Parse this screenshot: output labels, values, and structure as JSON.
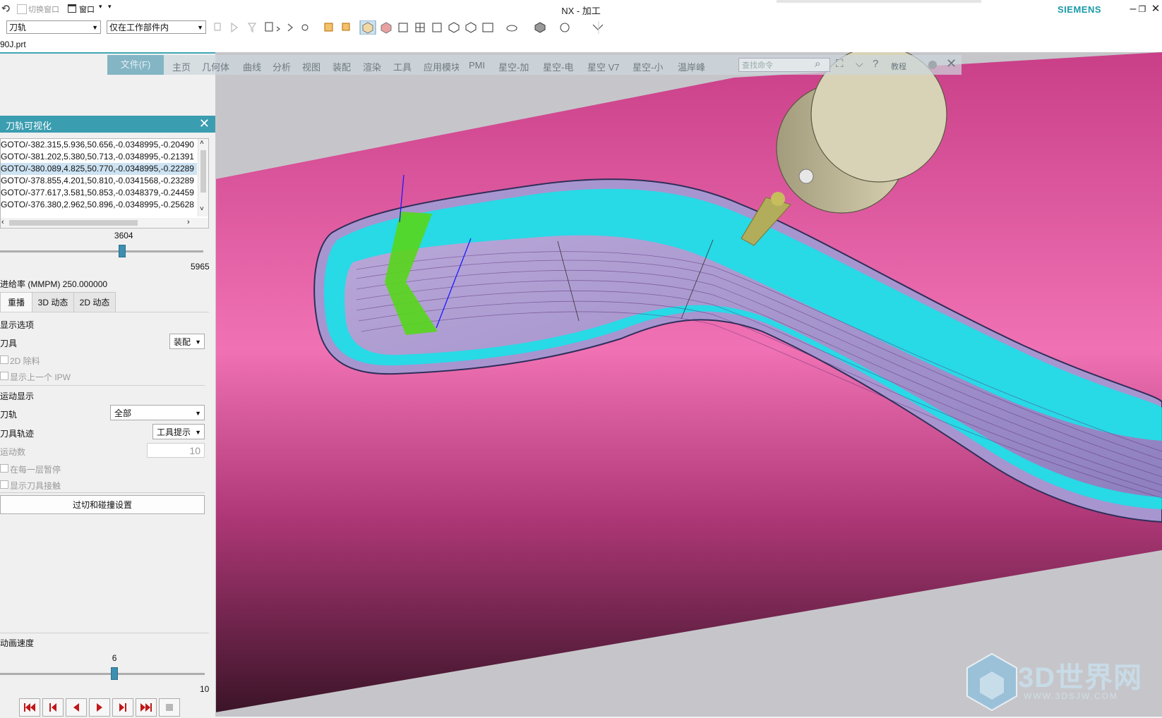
{
  "window": {
    "title": "NX - 加工",
    "brand": "SIEMENS",
    "top_left": {
      "switch_window": "切换窗口",
      "window_menu": "窗口"
    }
  },
  "toolbar": {
    "filter_type": "刀轨",
    "selection_scope": "仅在工作部件内"
  },
  "file_tab": {
    "name": "90J.prt"
  },
  "ribbon": {
    "file_button": "文件(F)",
    "tabs": [
      "主页",
      "几何体",
      "曲线",
      "分析",
      "视图",
      "装配",
      "渲染",
      "工具",
      "应用模块",
      "PMI",
      "星空-加",
      "星空-电",
      "星空 V7",
      "星空-小",
      "温岸峰"
    ],
    "search_placeholder": "查找命令",
    "tutorial": "教程"
  },
  "panel": {
    "title": "刀轨可视化",
    "goto_lines": [
      "GOTO/-382.315,5.936,50.656,-0.0348995,-0.20490",
      "GOTO/-381.202,5.380,50.713,-0.0348995,-0.21391",
      "GOTO/-380.089,4.825,50.770,-0.0348995,-0.22289",
      "GOTO/-378.855,4.201,50.810,-0.0341568,-0.23289",
      "GOTO/-377.617,3.581,50.853,-0.0348379,-0.24459",
      "GOTO/-376.380,2.962,50.896,-0.0348995,-0.25628"
    ],
    "selected_line": 2,
    "position_slider": {
      "value": "3604",
      "max": "5965",
      "fraction": 0.604
    },
    "feed_rate": "进给率 (MMPM) 250.000000",
    "tabs": [
      "重播",
      "3D 动态",
      "2D 动态"
    ],
    "display_options": {
      "heading": "显示选项",
      "tool_label": "刀具",
      "tool_value": "装配",
      "chk_2d_removal": "2D 除料",
      "chk_prev_ipw": "显示上一个 IPW"
    },
    "motion_display": {
      "heading": "运动显示",
      "toolpath_label": "刀轨",
      "toolpath_value": "全部",
      "tool_trace_label": "刀具轨迹",
      "tool_trace_value": "工具提示",
      "motion_count_label": "运动数",
      "motion_count_value": "10",
      "chk_pause_each_layer": "在每一层暂停",
      "chk_show_tool_contact": "显示刀具接触"
    },
    "gouge_button": "过切和碰撞设置",
    "animation_speed": {
      "label": "动画速度",
      "value": "6",
      "max": "10",
      "fraction": 0.6
    }
  },
  "colors": {
    "accent": "#3b9db0",
    "background_pink": "#e04a98",
    "toolpath_cyan": "#00f2f2"
  },
  "watermark": {
    "text": "3D世界网",
    "url": "WWW.3DSJW.COM"
  }
}
